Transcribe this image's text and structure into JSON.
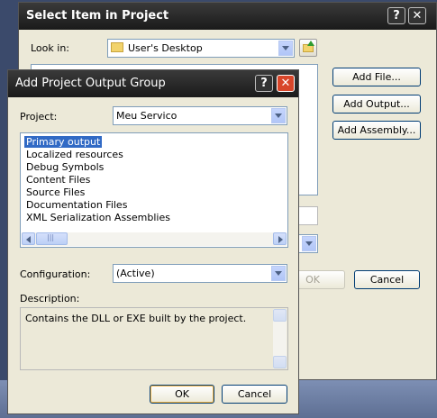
{
  "back_dialog": {
    "title": "Select Item in Project",
    "help": "?",
    "close": "✕",
    "look_in_label": "Look in:",
    "look_in_value": "User's Desktop",
    "add_file_label": "Add File...",
    "add_output_label": "Add Output...",
    "add_assembly_label": "Add Assembly...",
    "ok_label": "OK",
    "cancel_label": "Cancel"
  },
  "front_dialog": {
    "title": "Add Project Output Group",
    "help": "?",
    "close": "✕",
    "project_label": "Project:",
    "project_value": "Meu Servico",
    "output_items": [
      "Primary output",
      "Localized resources",
      "Debug Symbols",
      "Content Files",
      "Source Files",
      "Documentation Files",
      "XML Serialization Assemblies"
    ],
    "scroll_thumb_grip": "|||",
    "configuration_label": "Configuration:",
    "configuration_value": "(Active)",
    "description_label": "Description:",
    "description_text": "Contains the DLL or EXE built by the project.",
    "ok_label": "OK",
    "cancel_label": "Cancel"
  }
}
